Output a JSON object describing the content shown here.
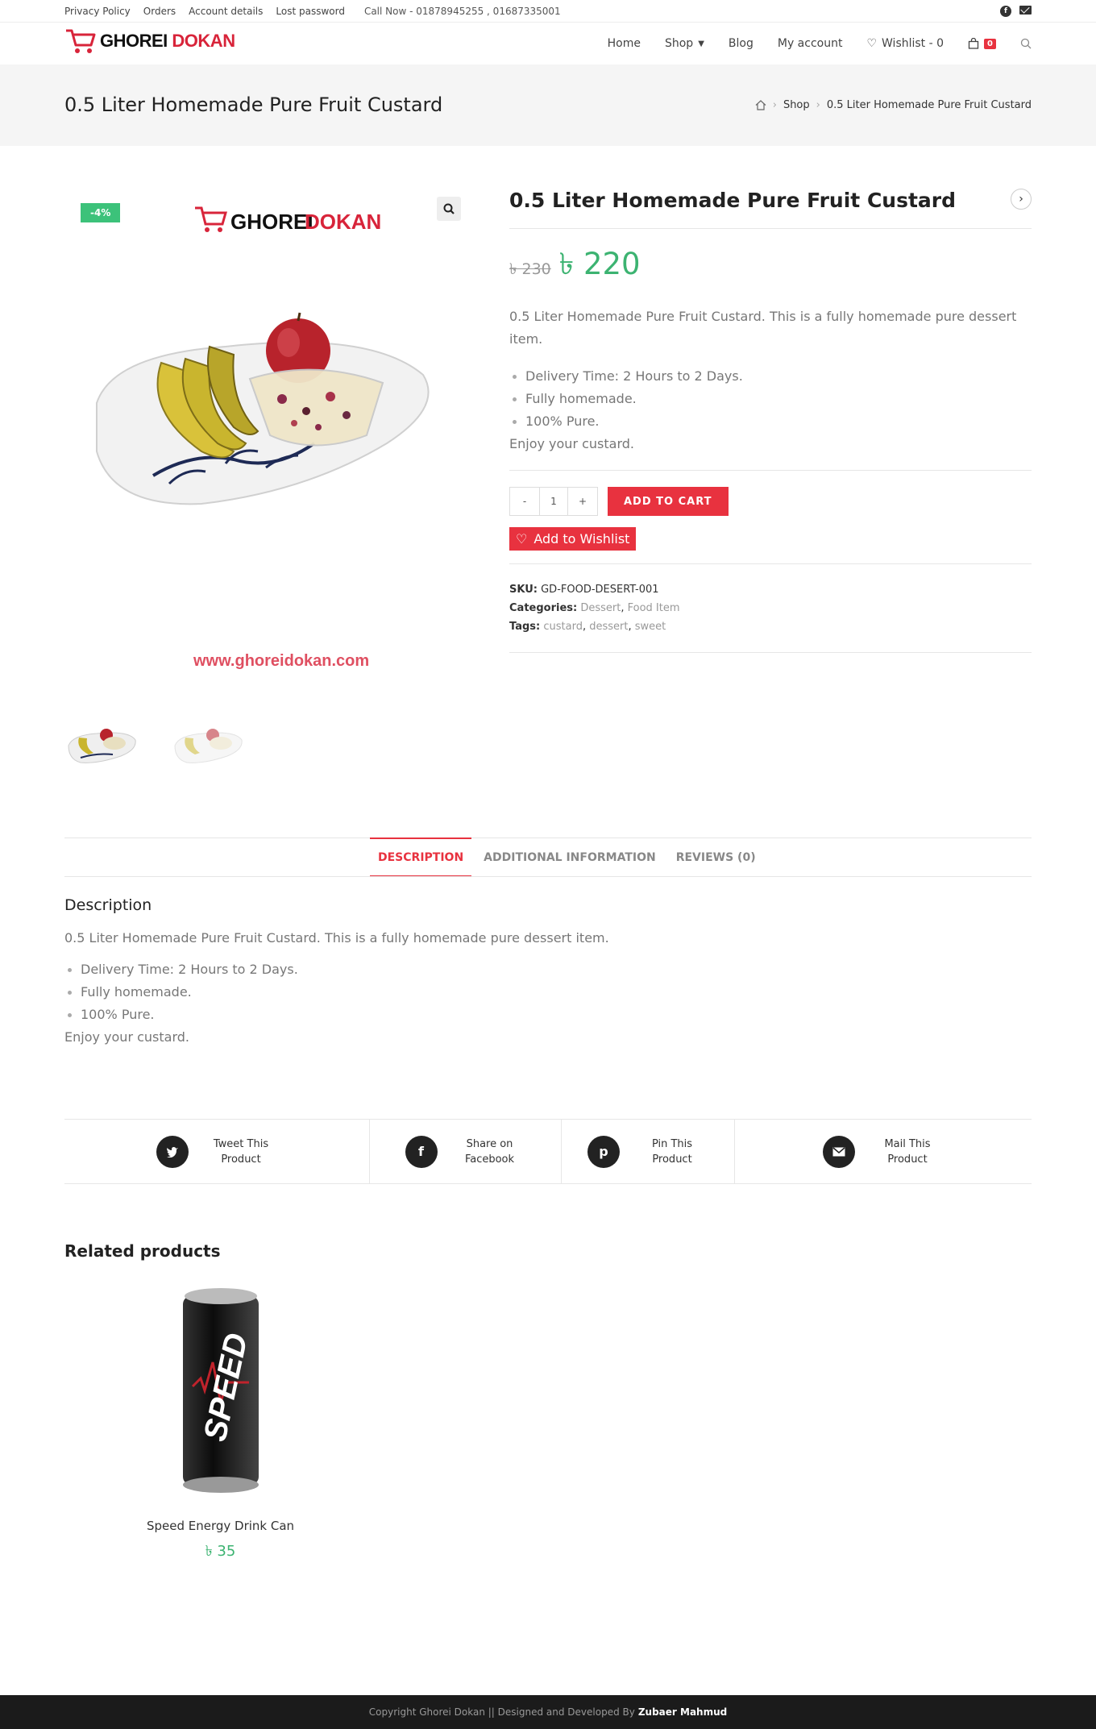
{
  "topbar": {
    "links": [
      "Privacy Policy",
      "Orders",
      "Account details",
      "Lost password"
    ],
    "call": "Call Now - 01878945255 , 01687335001"
  },
  "logo": {
    "part1": "GHOREI",
    "part2": "DOKAN"
  },
  "nav": {
    "home": "Home",
    "shop": "Shop",
    "blog": "Blog",
    "my_account": "My account",
    "wishlist": "Wishlist - 0",
    "cart_count": "0"
  },
  "page_title": "0.5 Liter Homemade Pure Fruit Custard",
  "breadcrumb": {
    "shop": "Shop",
    "current": "0.5 Liter Homemade Pure Fruit Custard"
  },
  "gallery": {
    "sale_badge": "-4%",
    "watermark": "www.ghoreidokan.com"
  },
  "product": {
    "title": "0.5 Liter Homemade Pure Fruit Custard",
    "old_price": "৳ 230",
    "new_price": "৳ 220",
    "short_description": "0.5 Liter Homemade Pure Fruit Custard. This is a fully homemade pure dessert item.",
    "bullets": [
      "Delivery Time: 2 Hours to 2 Days.",
      "Fully homemade.",
      "100% Pure."
    ],
    "closing": "Enjoy your custard.",
    "qty_minus": "-",
    "qty_value": "1",
    "qty_plus": "+",
    "add_to_cart": "ADD TO CART",
    "add_to_wishlist": "Add to Wishlist",
    "sku_label": "SKU:",
    "sku": "GD-FOOD-DESERT-001",
    "categories_label": "Categories:",
    "categories": [
      "Dessert",
      "Food Item"
    ],
    "tags_label": "Tags:",
    "tags": [
      "custard",
      "dessert",
      "sweet"
    ]
  },
  "tabs": [
    "DESCRIPTION",
    "ADDITIONAL INFORMATION",
    "REVIEWS (0)"
  ],
  "description": {
    "heading": "Description",
    "text": "0.5 Liter Homemade Pure Fruit Custard. This is a fully homemade pure dessert item.",
    "bullets": [
      "Delivery Time: 2 Hours to 2 Days.",
      "Fully homemade.",
      "100% Pure."
    ],
    "closing": "Enjoy your custard."
  },
  "share": [
    {
      "icon": "twitter-icon",
      "line1": "Tweet This",
      "line2": "Product"
    },
    {
      "icon": "facebook-icon",
      "line1": "Share on",
      "line2": "Facebook"
    },
    {
      "icon": "pinterest-icon",
      "line1": "Pin This",
      "line2": "Product"
    },
    {
      "icon": "mail-icon",
      "line1": "Mail This",
      "line2": "Product"
    }
  ],
  "related": {
    "title": "Related products",
    "items": [
      {
        "name": "Speed Energy Drink Can",
        "price": "৳ 35"
      }
    ]
  },
  "footer": {
    "text": "Copyright Ghorei Dokan || Designed and Developed By",
    "author": "Zubaer Mahmud"
  },
  "colors": {
    "accent": "#e8323f",
    "price_green": "#3cb371",
    "sale_badge": "#3cc27a"
  }
}
